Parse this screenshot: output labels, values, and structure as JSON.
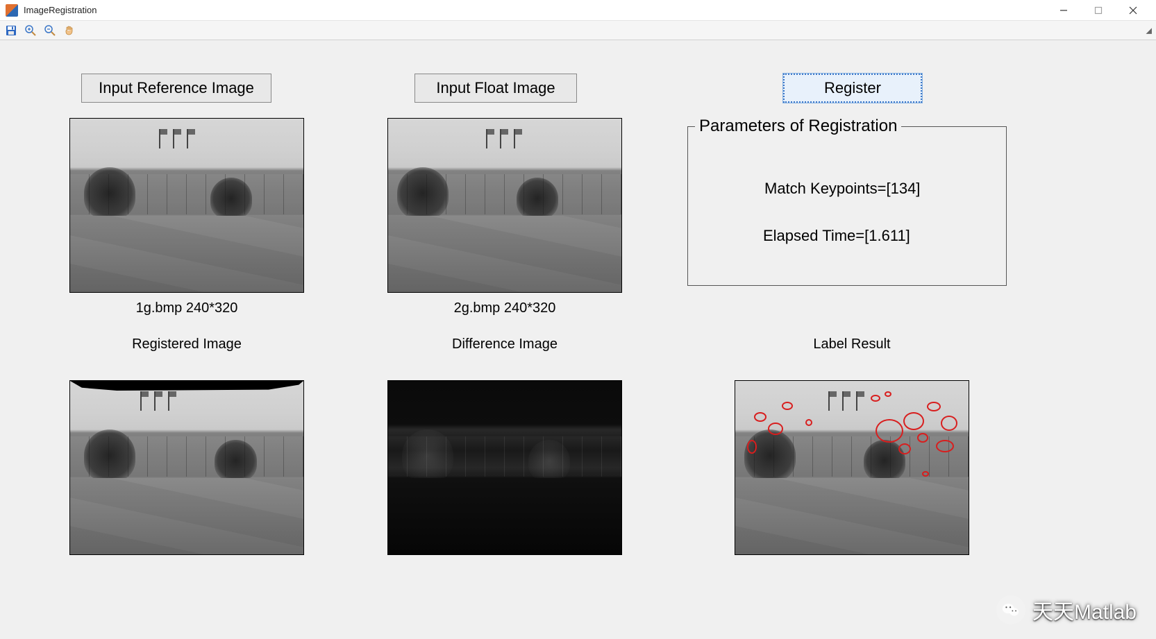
{
  "window": {
    "title": "ImageRegistration"
  },
  "buttons": {
    "input_reference": "Input Reference Image",
    "input_float": "Input Float Image",
    "register": "Register"
  },
  "images": {
    "reference_caption": "1g.bmp 240*320",
    "float_caption": "2g.bmp 240*320",
    "registered_label": "Registered Image",
    "difference_label": "Difference Image",
    "label_result_label": "Label Result"
  },
  "params": {
    "legend": "Parameters of Registration",
    "match_keypoints_label": "Match Keypoints=",
    "match_keypoints_value": "[134]",
    "elapsed_time_label": "Elapsed Time=",
    "elapsed_time_value": "[1.611]"
  },
  "watermark": {
    "text": "天天Matlab"
  }
}
